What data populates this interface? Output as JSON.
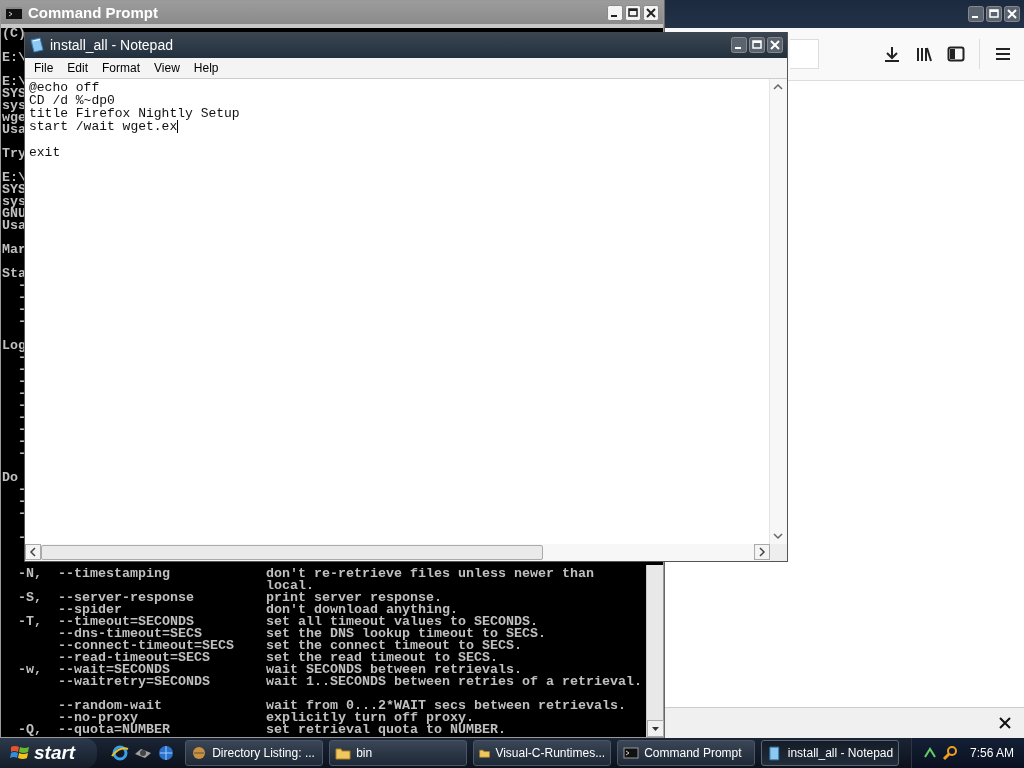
{
  "command_prompt": {
    "title": "Command Prompt",
    "active": false,
    "fragment_blocks": [
      [
        "(C)"
      ],
      [
        "E:\\"
      ],
      [
        "E:\\",
        "SYS",
        "sys",
        "wge",
        "Usa"
      ],
      [
        "Try"
      ],
      [
        "E:\\",
        "SYS",
        "sys",
        "GNU",
        "Usa"
      ],
      [
        "Mar"
      ],
      [
        "Sta",
        "  -",
        "  -",
        "  -",
        "  -"
      ],
      [
        "Log",
        "  -",
        "  -",
        "  -",
        "  -",
        "  -",
        "  -",
        "  -",
        "  -",
        "  -"
      ],
      [
        "Do",
        "  -",
        "  -",
        "  -"
      ],
      [
        "  -"
      ]
    ],
    "help_groups": [
      [
        {
          "flag": "-N,",
          "option": "--timestamping",
          "description": "don't re-retrieve files unless newer than"
        },
        {
          "description": "local."
        },
        {
          "flag": "-S,",
          "option": "--server-response",
          "description": "print server response."
        },
        {
          "option": "--spider",
          "description": "don't download anything."
        },
        {
          "flag": "-T,",
          "option": "--timeout=SECONDS",
          "description": "set all timeout values to SECONDS."
        },
        {
          "option": "--dns-timeout=SECS",
          "description": "set the DNS lookup timeout to SECS."
        },
        {
          "option": "--connect-timeout=SECS",
          "description": "set the connect timeout to SECS."
        },
        {
          "option": "--read-timeout=SECS",
          "description": "set the read timeout to SECS."
        },
        {
          "flag": "-w,",
          "option": "--wait=SECONDS",
          "description": "wait SECONDS between retrievals."
        },
        {
          "option": "--waitretry=SECONDS",
          "description": "wait 1..SECONDS between retries of a retrieval."
        }
      ],
      [
        {
          "option": "--random-wait",
          "description": "wait from 0...2*WAIT secs between retrievals."
        },
        {
          "option": "--no-proxy",
          "description": "explicitly turn off proxy."
        },
        {
          "flag": "-Q,",
          "option": "--quota=NUMBER",
          "description": "set retrieval quota to NUMBER."
        }
      ]
    ]
  },
  "notepad": {
    "title": "install_all - Notepad",
    "active": true,
    "menu": [
      "File",
      "Edit",
      "Format",
      "View",
      "Help"
    ],
    "paragraphs": [
      [
        {
          "text": "@echo off",
          "caret": false
        },
        {
          "text": "CD /d %~dp0",
          "caret": false
        },
        {
          "text": "title Firefox Nightly Setup",
          "caret": false
        },
        {
          "text": "start /wait wget.ex",
          "caret": true
        }
      ],
      [
        {
          "text": "exit",
          "caret": false
        }
      ]
    ]
  },
  "taskbar": {
    "start_label": "start",
    "tasks": [
      {
        "label": "Directory Listing: ...",
        "kind": "browser",
        "selected": false
      },
      {
        "label": "bin",
        "kind": "folder",
        "selected": false
      },
      {
        "label": "Visual-C-Runtimes...",
        "kind": "folder",
        "selected": false
      },
      {
        "label": "Command Prompt",
        "kind": "console",
        "selected": false
      },
      {
        "label": "install_all - Notepad",
        "kind": "notepad",
        "selected": true
      }
    ],
    "clock": "7:56 AM"
  }
}
